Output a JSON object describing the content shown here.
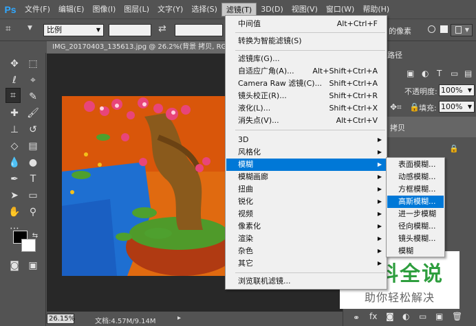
{
  "app": {
    "logo": "Ps"
  },
  "menubar": {
    "items": [
      "文件(F)",
      "编辑(E)",
      "图像(I)",
      "图层(L)",
      "文字(Y)",
      "选择(S)",
      "滤镜(T)",
      "3D(D)",
      "视图(V)",
      "窗口(W)",
      "帮助(H)"
    ]
  },
  "options": {
    "ratio_value": "比例",
    "swap_icon": "swap-arrows-icon",
    "right_text": "的像素"
  },
  "document": {
    "tab_title": "IMG_20170403_135613.jpg @ 26.2%(背景 拷贝, RGB"
  },
  "status": {
    "zoom": "26.15%",
    "info": "文档:4.57M/9.14M"
  },
  "panel": {
    "tab_fragment": "路径",
    "opacity_label": "不透明度:",
    "opacity_value": "100%",
    "fill_label": "填充:",
    "fill_value": "100%",
    "layer_name": "拷贝"
  },
  "filter_menu": {
    "items": [
      {
        "label": "中间值",
        "shortcut": "Alt+Ctrl+F"
      },
      {
        "label": "转换为智能滤镜(S)",
        "shortcut": ""
      },
      {
        "label": "滤镜库(G)...",
        "shortcut": ""
      },
      {
        "label": "自适应广角(A)...",
        "shortcut": "Alt+Shift+Ctrl+A"
      },
      {
        "label": "Camera Raw 滤镜(C)...",
        "shortcut": "Shift+Ctrl+A"
      },
      {
        "label": "镜头校正(R)...",
        "shortcut": "Shift+Ctrl+R"
      },
      {
        "label": "液化(L)...",
        "shortcut": "Shift+Ctrl+X"
      },
      {
        "label": "消失点(V)...",
        "shortcut": "Alt+Ctrl+V"
      },
      {
        "label": "3D",
        "shortcut": ""
      },
      {
        "label": "风格化",
        "shortcut": ""
      },
      {
        "label": "模糊",
        "shortcut": ""
      },
      {
        "label": "模糊画廊",
        "shortcut": ""
      },
      {
        "label": "扭曲",
        "shortcut": ""
      },
      {
        "label": "锐化",
        "shortcut": ""
      },
      {
        "label": "视频",
        "shortcut": ""
      },
      {
        "label": "像素化",
        "shortcut": ""
      },
      {
        "label": "渲染",
        "shortcut": ""
      },
      {
        "label": "杂色",
        "shortcut": ""
      },
      {
        "label": "其它",
        "shortcut": ""
      },
      {
        "label": "浏览联机滤镜...",
        "shortcut": ""
      }
    ]
  },
  "blur_menu": {
    "items": [
      "表面模糊...",
      "动感模糊...",
      "方框模糊...",
      "高斯模糊...",
      "进一步模糊",
      "径向模糊...",
      "镜头模糊...",
      "模糊"
    ]
  },
  "watermark": {
    "title": "百科全说",
    "subtitle": "助你轻松解决"
  },
  "colors": {
    "accent": "#0078d7",
    "chrome": "#535353",
    "watermark_green": "#2e9e3e"
  }
}
